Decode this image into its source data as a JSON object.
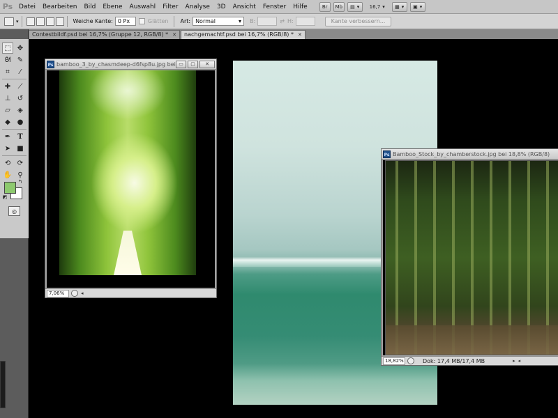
{
  "app": {
    "logo": "Ps"
  },
  "menubar": {
    "items": [
      "Datei",
      "Bearbeiten",
      "Bild",
      "Ebene",
      "Auswahl",
      "Filter",
      "Analyse",
      "3D",
      "Ansicht",
      "Fenster",
      "Hilfe"
    ],
    "bridge_label": "Br",
    "minibridge_label": "Mb",
    "zoom_value": "16,7"
  },
  "options": {
    "feather_label": "Weiche Kante:",
    "feather_value": "0 Px",
    "antialias_label": "Glätten",
    "style_label": "Art:",
    "style_value": "Normal",
    "width_label": "B:",
    "height_label": "H:",
    "refine_edge_label": "Kante verbessern..."
  },
  "tabs": [
    {
      "label": "Contestbildf.psd bei 16,7% (Gruppe 12, RGB/8) *"
    },
    {
      "label": "nachgemachtf.psd bei 16,7% (RGB/8) *"
    }
  ],
  "windows": {
    "bamboo3": {
      "title": "bamboo_3_by_chasmdeep-d6fsp8u.jpg bei...",
      "zoom": "7,06%"
    },
    "stock": {
      "title": "Bamboo_Stock_by_chamberstock.jpg bei 18,8% (RGB/8)",
      "zoom": "18,82%",
      "doc_info": "Dok: 17,4 MB/17,4 MB"
    }
  },
  "colors": {
    "foreground": "#8dc96e",
    "background": "#ffffff"
  },
  "icons": {
    "close": "✕",
    "maximize": "▢",
    "minimize": "▭"
  }
}
